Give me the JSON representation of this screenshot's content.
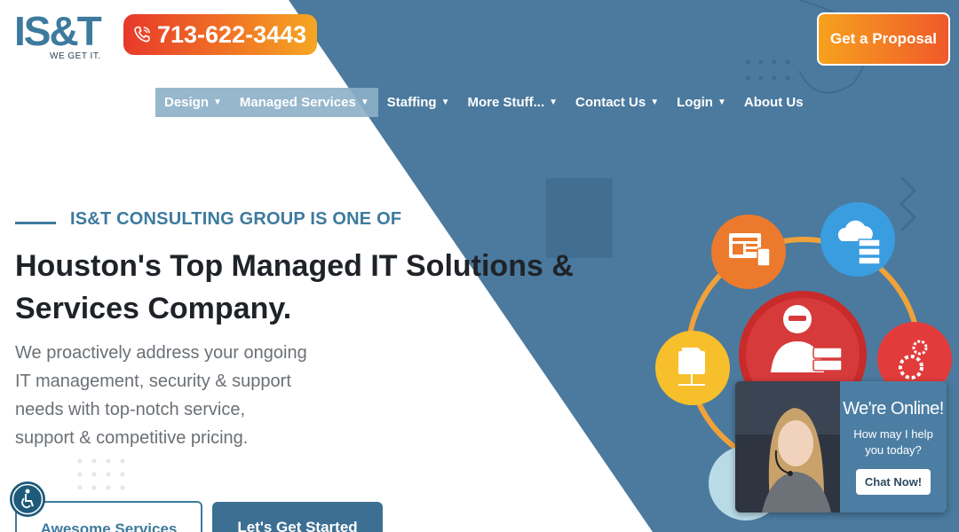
{
  "brand": {
    "logo_text": "IS&T",
    "tagline": "WE GET IT.",
    "accent": "#3d7a9e",
    "primary_dark": "#3d6f92",
    "orange": "#f07a24"
  },
  "header": {
    "phone": "713-622-3443",
    "phone_icon": "phone-icon",
    "cta": "Get a Proposal"
  },
  "nav": {
    "items": [
      {
        "label": "Design",
        "icon": "chevron-down-icon"
      },
      {
        "label": "Managed Services",
        "icon": "chevron-down-icon"
      },
      {
        "label": "Staffing",
        "icon": "chevron-down-icon"
      },
      {
        "label": "More Stuff...",
        "icon": "chevron-down-icon"
      },
      {
        "label": "Contact Us",
        "icon": "chevron-down-icon"
      },
      {
        "label": "Login",
        "icon": "chevron-down-icon"
      },
      {
        "label": "About Us"
      }
    ]
  },
  "hero": {
    "eyebrow": "IS&T CONSULTING GROUP IS ONE OF",
    "headline": "Houston's Top Managed IT Solutions & Services Company.",
    "body": "We proactively address your ongoing IT management, security & support needs with top-notch service, support & competitive pricing.",
    "primary_button": "Awesome Services",
    "secondary_button": "Let's Get Started",
    "icons": [
      "web-design-icon",
      "cloud-server-icon",
      "support-agent-icon",
      "network-folder-icon",
      "gears-icon"
    ]
  },
  "chat": {
    "title": "We're Online!",
    "question": "How may I help you today?",
    "button": "Chat Now!"
  },
  "accessibility": {
    "icon": "accessibility-icon"
  }
}
